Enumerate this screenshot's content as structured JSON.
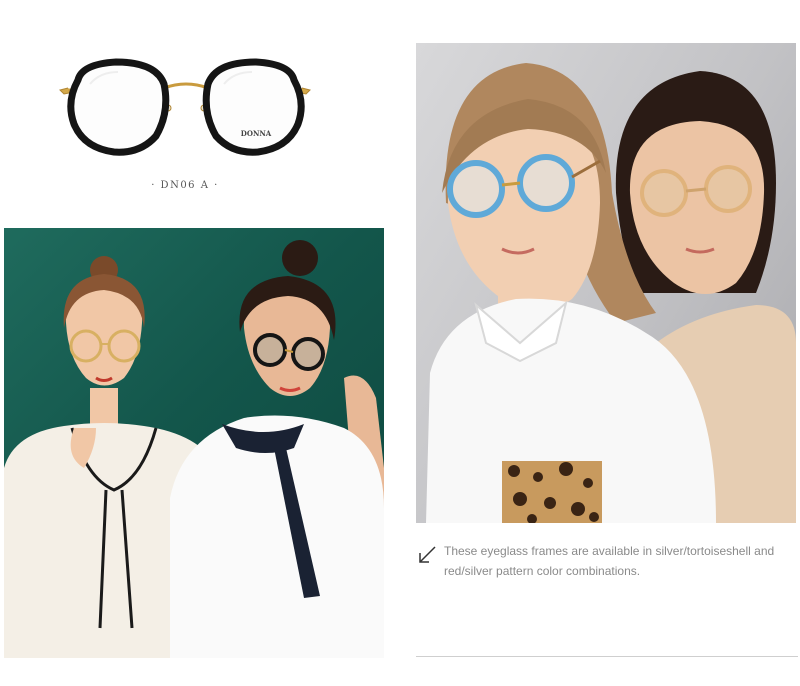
{
  "product": {
    "model_code": "· DN06 A ·",
    "brand_on_lens": "DONNA",
    "frame_color": "#151515",
    "temple_color": "#d4a94a"
  },
  "photos": {
    "green_backdrop": "#17604f",
    "grey_backdrop": "#c4c4c7"
  },
  "caption": {
    "text": "These eyeglass frames are available in silver/tortoiseshell and red/silver pattern color combinations."
  }
}
